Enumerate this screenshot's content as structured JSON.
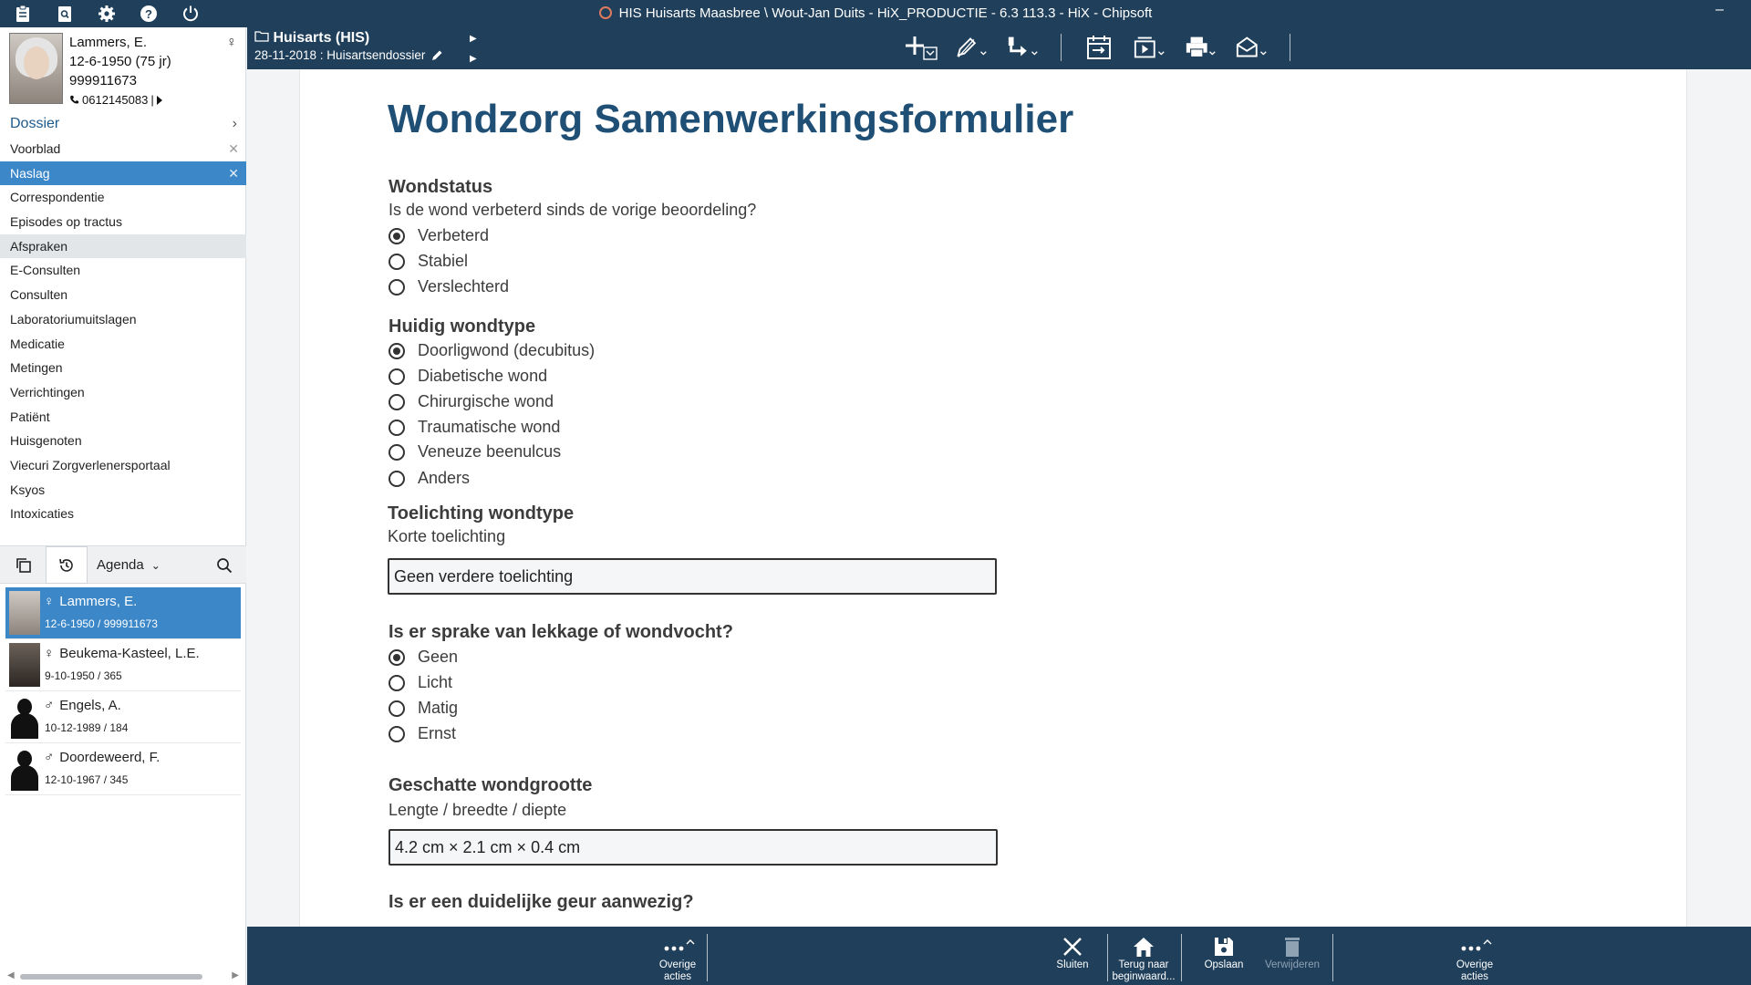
{
  "window": {
    "title": "HIS Huisarts Maasbree \\ Wout-Jan Duits - HiX_PRODUCTIE - 6.3 113.3 - HiX - Chipsoft",
    "minimize": "–"
  },
  "patient": {
    "name": "Lammers, E.",
    "dob": "12-6-1950 (75 jr)",
    "id": "999911673",
    "phone": "0612145083"
  },
  "nav": {
    "header": "Dossier",
    "items": [
      {
        "label": "Voorblad"
      },
      {
        "label": "Naslag"
      },
      {
        "label": "Correspondentie"
      },
      {
        "label": "Episodes op tractus"
      },
      {
        "label": "Afspraken"
      },
      {
        "label": "E-Consulten"
      },
      {
        "label": "Consulten"
      },
      {
        "label": "Laboratoriumuitslagen"
      },
      {
        "label": "Medicatie"
      },
      {
        "label": "Metingen"
      },
      {
        "label": "Verrichtingen"
      },
      {
        "label": "Patiënt"
      },
      {
        "label": "Huisgenoten"
      },
      {
        "label": "Viecuri Zorgverlenersportaal"
      },
      {
        "label": "Ksyos"
      },
      {
        "label": "Intoxicaties"
      }
    ]
  },
  "list_toolbar": {
    "agenda_label": "Agenda"
  },
  "patient_list": [
    {
      "name": "Lammers, E.",
      "sex": "♀",
      "sub": "12-6-1950 / 999911673"
    },
    {
      "name": "Beukema-Kasteel, L.E.",
      "sex": "♀",
      "sub": "9-10-1950 / 365"
    },
    {
      "name": "Engels, A.",
      "sex": "♂",
      "sub": "10-12-1989 / 184"
    },
    {
      "name": "Doordeweerd, F.",
      "sex": "♂",
      "sub": "12-10-1967 / 345"
    }
  ],
  "breadcrumb": {
    "folder": "Huisarts (HIS)",
    "sub": "28-11-2018 : Huisartsendossier"
  },
  "form": {
    "title": "Wondzorg Samenwerkingsformulier",
    "q1": {
      "title": "Wondstatus",
      "sub": "Is de wond verbeterd sinds de vorige beoordeling?",
      "options": [
        "Verbeterd",
        "Stabiel",
        "Verslechterd"
      ],
      "selected": 0
    },
    "q2": {
      "title": "Huidig wondtype",
      "options": [
        "Doorligwond (decubitus)",
        "Diabetische wond",
        "Chirurgische wond",
        "Traumatische wond",
        "Veneuze beenulcus",
        "Anders"
      ],
      "selected": 0
    },
    "q3": {
      "title": "Toelichting wondtype",
      "sub": "Korte toelichting",
      "value": "Geen verdere toelichting"
    },
    "q4": {
      "title": "Is er sprake van lekkage of wondvocht?",
      "options": [
        "Geen",
        "Licht",
        "Matig",
        "Ernst"
      ],
      "selected": 0
    },
    "q5": {
      "title": "Geschatte wondgrootte",
      "sub": "Lengte / breedte / diepte",
      "value": "4.2 cm × 2.1 cm × 0.4 cm"
    },
    "q6": {
      "title": "Is er een duidelijke geur aanwezig?"
    }
  },
  "actions": {
    "more_left": [
      "Overige",
      "acties"
    ],
    "close": "Sluiten",
    "home": [
      "Terug naar",
      "beginwaard..."
    ],
    "save": "Opslaan",
    "delete": "Verwijderen",
    "more_right": [
      "Overige",
      "acties"
    ]
  },
  "colors": {
    "brand_dark": "#1f3f5b",
    "title_blue": "#1f4f75",
    "selection": "#3b87c8"
  }
}
